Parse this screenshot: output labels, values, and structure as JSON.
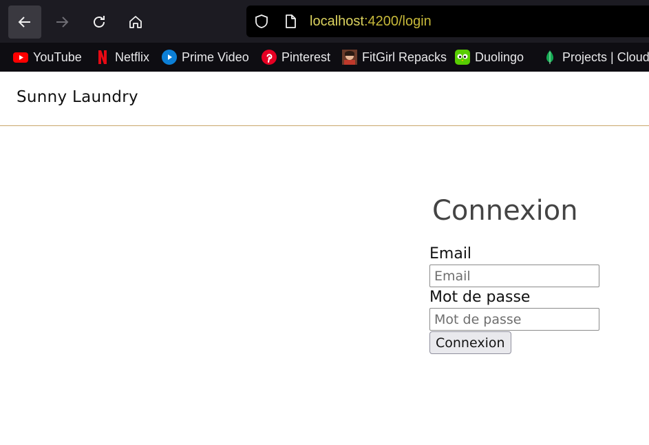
{
  "browser": {
    "url_host": "localhost",
    "url_path": ":4200/login",
    "icons": [
      "back-arrow-icon",
      "forward-arrow-icon",
      "reload-icon",
      "home-icon",
      "shield-icon",
      "page-icon"
    ]
  },
  "bookmarks": [
    {
      "label": "YouTube",
      "icon": "youtube-icon",
      "color": "#ff0000"
    },
    {
      "label": "Netflix",
      "icon": "netflix-icon",
      "color": "#e50914"
    },
    {
      "label": "Prime Video",
      "icon": "prime-video-icon",
      "color": "#1399ff"
    },
    {
      "label": "Pinterest",
      "icon": "pinterest-icon",
      "color": "#e60023"
    },
    {
      "label": "FitGirl Repacks",
      "icon": "fitgirl-icon",
      "color": "#a3572e"
    },
    {
      "label": "Duolingo",
      "icon": "duolingo-icon",
      "color": "#58cc02"
    },
    {
      "label": "Projects | Cloud:",
      "icon": "mongodb-leaf-icon",
      "color": "#13aa52"
    }
  ],
  "app": {
    "brand": "Sunny Laundry",
    "accent_line": "#c9a56a"
  },
  "login": {
    "title": "Connexion",
    "email_label": "Email",
    "email_placeholder": "Email",
    "password_label": "Mot de passe",
    "password_placeholder": "Mot de passe",
    "submit_label": "Connexion"
  }
}
